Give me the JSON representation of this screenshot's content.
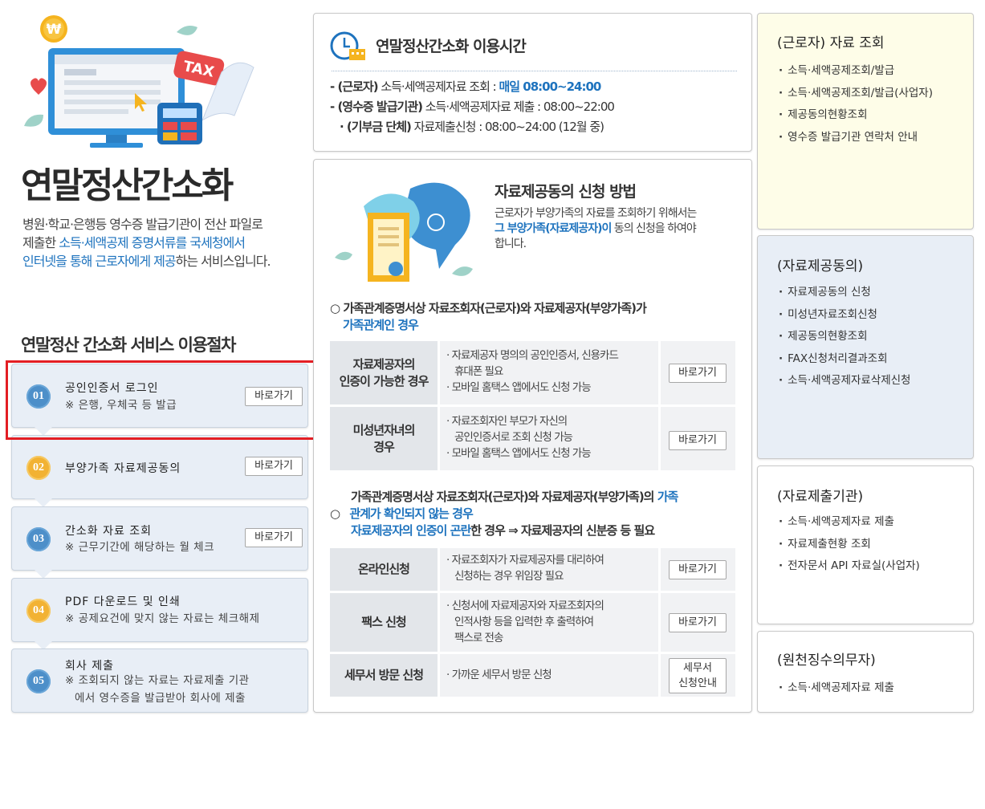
{
  "hero": {
    "title": "연말정산간소화",
    "intro_1": "병원·학교·은행등 영수증 발급기관이 전산 파일로",
    "intro_2a": "제출한 ",
    "intro_2b": "소득·세액공제 증명서류를 국세청에서",
    "intro_3a": "인터넷을 통해 근로자에게 제공",
    "intro_3b": "하는 서비스입니다.",
    "tax_label": "TAX",
    "won_label": "₩"
  },
  "procedure": {
    "title": "연말정산 간소화 서비스 이용절차",
    "go_label": "바로가기",
    "steps": [
      {
        "num": "01",
        "title": "공인인증서 로그인",
        "note_1": "※ 은행, 우체국 등 발급",
        "note_2": ""
      },
      {
        "num": "02",
        "title": "부양가족 자료제공동의",
        "note_1": "",
        "note_2": ""
      },
      {
        "num": "03",
        "title": "간소화 자료 조회",
        "note_1": "※ 근무기간에 해당하는 월 체크",
        "note_2": ""
      },
      {
        "num": "04",
        "title": "PDF 다운로드 및 인쇄",
        "note_1": "※ 공제요건에 맞지 않는 자료는 체크해제",
        "note_2": ""
      },
      {
        "num": "05",
        "title": "회사 제출",
        "note_1": "※ 조회되지 않는 자료는 자료제출 기관",
        "note_2": "에서 영수증을 발급받아 회사에 제출"
      }
    ]
  },
  "time": {
    "title": "연말정산간소화 이용시간",
    "l1_a": "- (근로자)",
    "l1_b": " 소득·세액공제자료 조회 : ",
    "l1_c": "매일 08:00~24:00",
    "l2_a": "- (영수증 발급기관)",
    "l2_b": " 소득·세액공제자료 제출 : 08:00~22:00",
    "l3_a": "· (기부금 단체)",
    "l3_b": " 자료제출신청 : 08:00~24:00 (12월 중)"
  },
  "apply": {
    "title": "자료제공동의 신청 방법",
    "desc_1": "근로자가 부양가족의 자료를 조회하기 위해서는",
    "desc_2a": "그 부양가족(자료제공자)이",
    "desc_2b": " 동의 신청을 하여야",
    "desc_3": "합니다.",
    "cond1_a": "가족관계증명서상 자료조회자(근로자)와 자료제공자(부양가족)가",
    "cond1_b": "가족관계인 경우",
    "cond2_a": "가족관계증명서상 자료조회자(근로자)와 자료제공자(부양가족)의 ",
    "cond2_b": "가족",
    "cond2_c": "관계가 확인되지 않는 경우",
    "cond2_d": "자료제공자의 인증이 곤란",
    "cond2_e": "한 경우 ⇒ 자료제공자의 신분증 등 필요",
    "rows": [
      {
        "label_1": "자료제공자의",
        "label_2": "인증이 가능한 경우",
        "d1": "· 자료제공자 명의의 공인인증서, 신용카드",
        "d2": "휴대폰 필요",
        "d3": "· 모바일 홈택스 앱에서도 신청 가능",
        "btn": "바로가기"
      },
      {
        "label_1": "미성년자녀의",
        "label_2": "경우",
        "d1": "· 자료조회자인 부모가 자신의",
        "d2": "공인인증서로 조회 신청 가능",
        "d3": "· 모바일 홈택스 앱에서도 신청 가능",
        "btn": "바로가기"
      },
      {
        "label_1": "온라인신청",
        "label_2": "",
        "d1": "· 자료조회자가 자료제공자를 대리하여",
        "d2": "신청하는 경우 위임장 필요",
        "d3": "",
        "btn": "바로가기"
      },
      {
        "label_1": "팩스 신청",
        "label_2": "",
        "d1": "· 신청서에 자료제공자와 자료조회자의",
        "d2": "인적사항 등을 입력한 후 출력하여",
        "d3": "팩스로 전송",
        "btn": "바로가기"
      },
      {
        "label_1": "세무서 방문 신청",
        "label_2": "",
        "d1": "· 가까운 세무서 방문 신청",
        "d2": "",
        "d3": "",
        "btn_1": "세무서",
        "btn_2": "신청안내"
      }
    ]
  },
  "side": {
    "worker": {
      "title": "(근로자) 자료 조회",
      "items": [
        "소득·세액공제조회/발급",
        "소득·세액공제조회/발급(사업자)",
        "제공동의현황조회",
        "영수증 발급기관 연락처 안내"
      ]
    },
    "consent": {
      "title": "(자료제공동의)",
      "items": [
        "자료제공동의 신청",
        "미성년자료조회신청",
        "제공동의현황조회",
        "FAX신청처리결과조회",
        "소득·세액공제자료삭제신청"
      ]
    },
    "issuer": {
      "title": "(자료제출기관)",
      "items": [
        "소득·세액공제자료 제출",
        "자료제출현황 조회",
        "전자문서 API 자료실(사업자)"
      ]
    },
    "withholder": {
      "title": "(원천징수의무자)",
      "items": [
        "소득·세액공제자료 제출"
      ]
    }
  },
  "colors": {
    "accent_blue": "#1e73be",
    "step_bg": "#e8eef6",
    "worker_bg": "#fefde8",
    "consent_bg": "#e8eef6",
    "highlight_red": "#e31e24"
  }
}
